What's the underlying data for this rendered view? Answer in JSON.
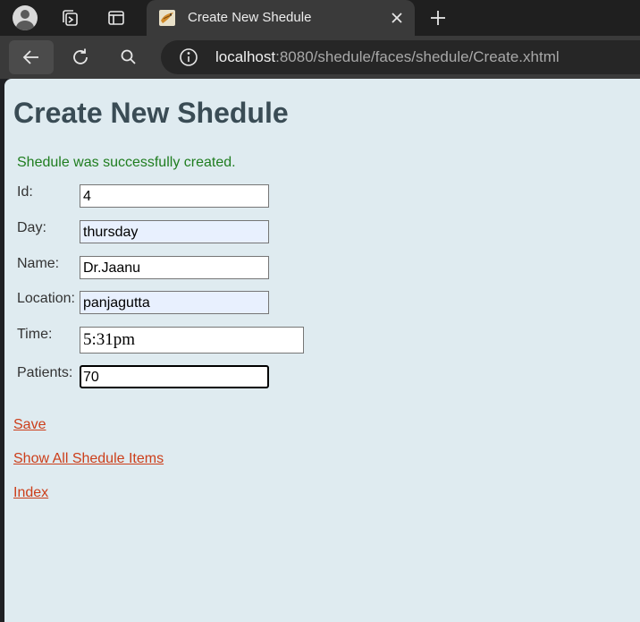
{
  "browser": {
    "tab_title": "Create New Shedule",
    "url_host": "localhost",
    "url_rest": ":8080/shedule/faces/shedule/Create.xhtml"
  },
  "page": {
    "heading": "Create New Shedule",
    "message": "Shedule was successfully created.",
    "fields": {
      "id": {
        "label": "Id:",
        "value": "4"
      },
      "day": {
        "label": "Day:",
        "value": "thursday"
      },
      "name": {
        "label": "Name:",
        "value": "Dr.Jaanu"
      },
      "location": {
        "label": "Location:",
        "value": "panjagutta"
      },
      "time": {
        "label": "Time:",
        "value": "5:31pm"
      },
      "patients": {
        "label": "Patients:",
        "value": "70"
      }
    },
    "links": {
      "save": "Save",
      "show_all": "Show All Shedule Items",
      "index": "Index"
    }
  },
  "colors": {
    "page_bg": "#dfebf0",
    "heading": "#3a4c55",
    "success": "#1f7d1f",
    "link": "#cc3e1a",
    "autofill": "#e8f0fe"
  }
}
